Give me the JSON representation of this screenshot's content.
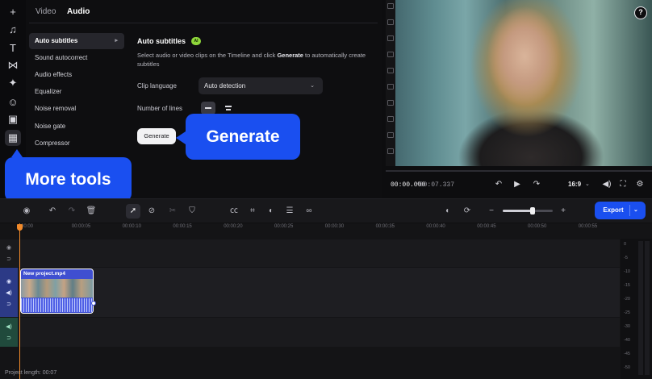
{
  "rail": {
    "icons": [
      "plus-icon",
      "music-icon",
      "text-icon",
      "transitions-icon",
      "effects-icon",
      "sticker-icon",
      "elements-icon",
      "more-tools-icon"
    ]
  },
  "tabs": {
    "video": "Video",
    "audio": "Audio"
  },
  "menu": {
    "items": [
      "Auto subtitles",
      "Sound autocorrect",
      "Audio effects",
      "Equalizer",
      "Noise removal",
      "Noise gate",
      "Compressor"
    ]
  },
  "subtitles": {
    "title": "Auto subtitles",
    "badge": "AI",
    "desc_before": "Select audio or video clips on the Timeline and click ",
    "desc_bold": "Generate",
    "desc_after": " to automatically create subtitles",
    "clip_language_label": "Clip language",
    "clip_language_value": "Auto detection",
    "lines_label": "Number of lines",
    "generate_label": "Generate"
  },
  "callouts": {
    "generate": "Generate",
    "more_tools": "More tools"
  },
  "preview": {
    "help": "?",
    "time_current": "00:00.000",
    "time_total": "/00:07.337",
    "ratio": "16:9"
  },
  "toolbar": {
    "export": "Export",
    "zoom_level": 0.6
  },
  "timeline": {
    "ticks": [
      "00:00",
      "00:00:05",
      "00:00:10",
      "00:00:15",
      "00:00:20",
      "00:00:25",
      "00:00:30",
      "00:00:35",
      "00:00:40",
      "00:00:45",
      "00:00:50",
      "00:00:55"
    ],
    "clip_name": "New project.mp4",
    "project_length": "Project length: 00:07"
  },
  "meter": {
    "db_labels": [
      "0",
      "-5",
      "-10",
      "-15",
      "-20",
      "-25",
      "-30",
      "-40",
      "-45",
      "-50"
    ]
  },
  "colors": {
    "accent": "#1a4ff0",
    "playhead": "#f28a2a",
    "ai_badge": "#8ed63a"
  }
}
